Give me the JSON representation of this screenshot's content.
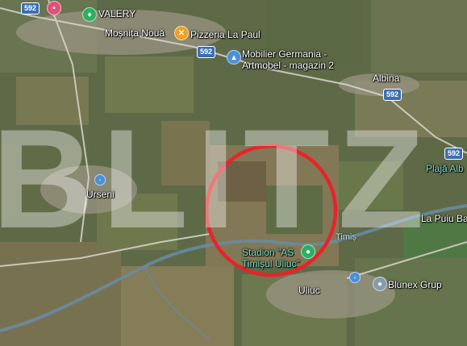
{
  "map": {
    "places": {
      "valery": "VALERY",
      "mosnita": "Moșnița Nouă",
      "pizzeria": "Pizzeria La Paul",
      "mobilier_line1": "Mobilier Germania -",
      "mobilier_line2": "Artmobel - magazin 2",
      "albina": "Albina",
      "plaja": "Plajă Alb",
      "urseni": "Urseni",
      "la_puiu": "La Puiu Ba",
      "stadion_line1": "Stadion \"AS",
      "stadion_line2": "Timișul Uliuc\"",
      "uliuc": "Uliuc",
      "blunex": "Blunex Grup",
      "river": "Timiș"
    },
    "road_shields": [
      "592",
      "592",
      "592",
      "592"
    ],
    "watermark": "BLITZ",
    "marker": "red-circle",
    "colors": {
      "circle": "#e8232b",
      "road_shield": "#3c6fb4",
      "river": "#6a8aa0",
      "pin_blue": "#4a8fd8",
      "pin_orange": "#f0a020",
      "pin_green": "#2fae62",
      "pin_grey": "#8899aa",
      "pin_pink": "#e0527a"
    }
  }
}
